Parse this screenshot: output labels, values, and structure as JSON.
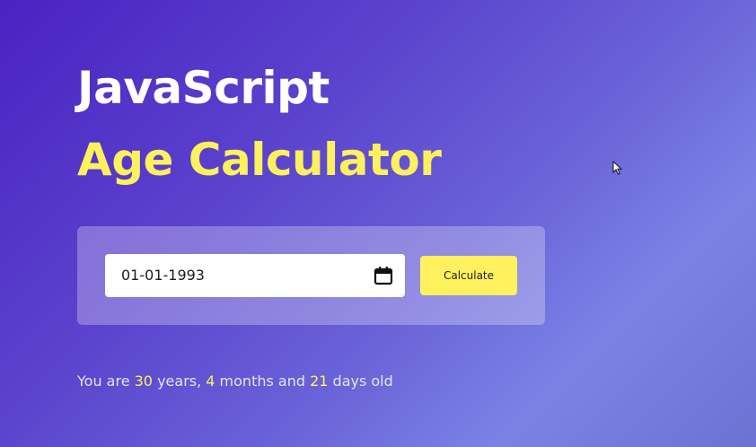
{
  "title": {
    "line1": "JavaScript",
    "line2": "Age Calculator"
  },
  "form": {
    "date_value": "01-01-1993",
    "calendar_icon": "calendar-icon",
    "button_label": "Calculate"
  },
  "result": {
    "prefix": "You are ",
    "years": "30",
    "years_label": " years, ",
    "months": "4",
    "months_label": " months and ",
    "days": "21",
    "days_label": " days old"
  },
  "colors": {
    "accent": "#fff15e",
    "title": "#ffffff",
    "background_start": "#4a22c2",
    "background_end": "#7a82e6"
  },
  "cursor_icon": "arrow-pointer-icon"
}
